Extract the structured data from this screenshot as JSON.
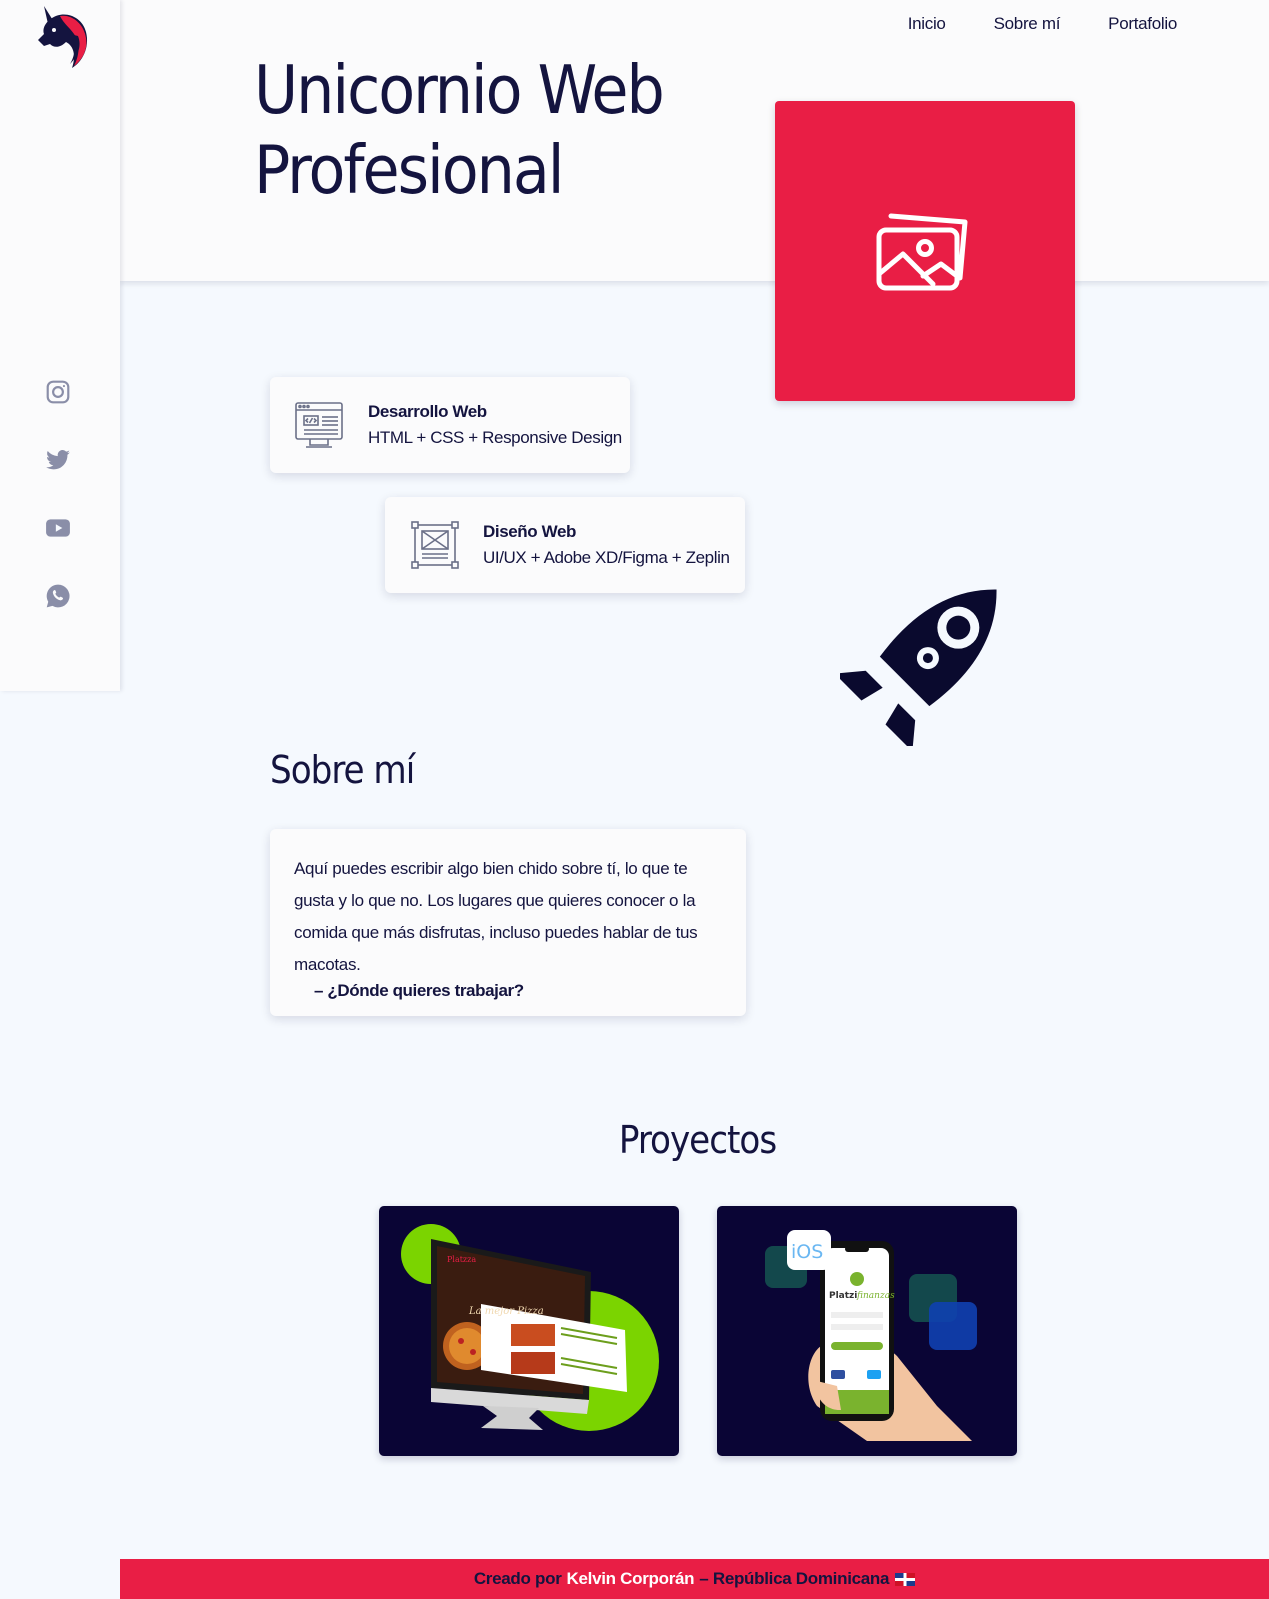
{
  "nav": [
    "Inicio",
    "Sobre mí",
    "Portafolio"
  ],
  "hero": {
    "title_line1": "Unicornio Web",
    "title_line2": "Profesional",
    "image_icon": "photos-icon",
    "accent": "#e91e45"
  },
  "social": [
    "instagram-icon",
    "twitter-icon",
    "youtube-icon",
    "whatsapp-icon"
  ],
  "skills": [
    {
      "title": "Desarrollo Web",
      "desc": "HTML + CSS + Responsive Design",
      "icon": "code-window-icon"
    },
    {
      "title": "Diseño Web",
      "desc": "UI/UX + Adobe XD/Figma + Zeplin",
      "icon": "wireframe-icon"
    }
  ],
  "about": {
    "title": "Sobre mí",
    "text": "Aquí puedes escribir algo bien chido sobre tí, lo que te gusta y lo que no. Los lugares que quieres conocer o la comida que más disfrutas, incluso puedes hablar de tus macotas.",
    "quote": "– ¿Dónde quieres trabajar?"
  },
  "projects": {
    "title": "Proyectos",
    "items": [
      {
        "brand": "Platzza",
        "hero": "La mejor Pizza"
      },
      {
        "brand_a": "Platzi",
        "brand_b": "finanzas",
        "badge": "iOS"
      }
    ]
  },
  "footer": {
    "prefix": "Creado por",
    "author": "Kelvin Corporán",
    "suffix": "– República Dominicana"
  },
  "colors": {
    "navy": "#14143f",
    "red": "#e91e45",
    "bg": "#f5f9fe",
    "project_bg": "#0a0535"
  }
}
